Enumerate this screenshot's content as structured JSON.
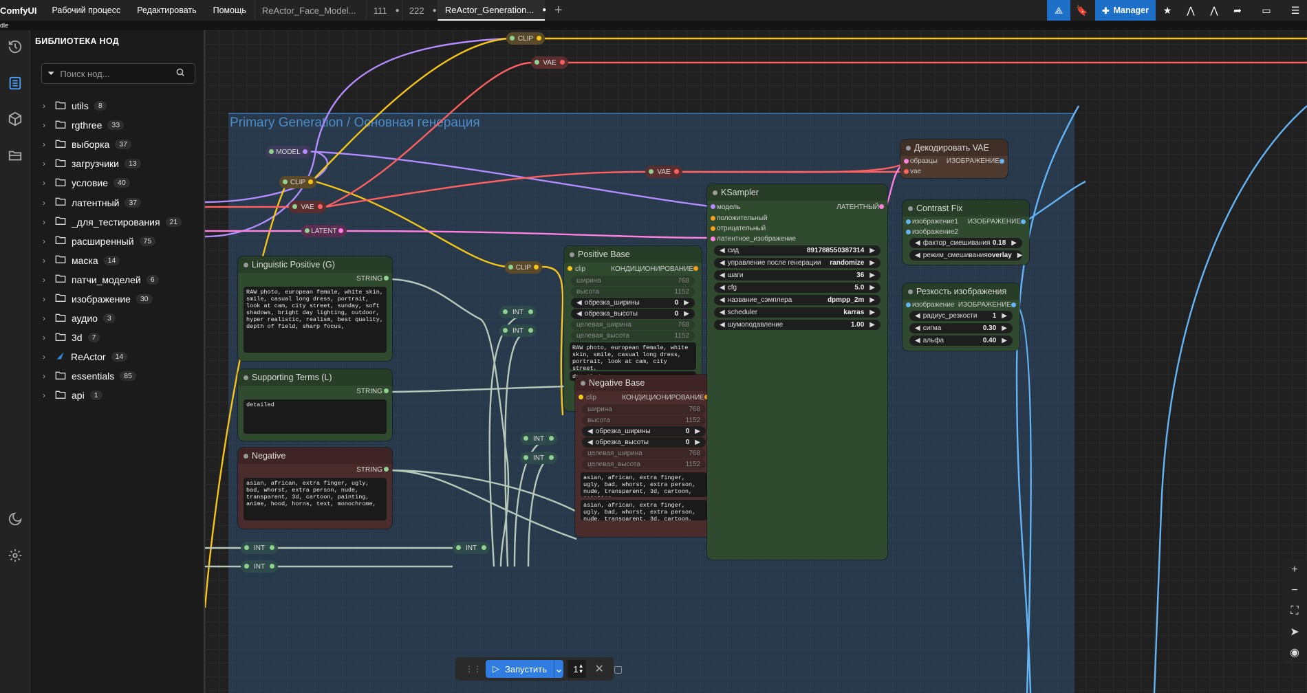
{
  "topbar": {
    "logo": "ComfyUI",
    "menu": [
      "Рабочий процесс",
      "Редактировать",
      "Помощь"
    ],
    "tabs": [
      {
        "label": "ReActor_Face_Model...",
        "active": false,
        "dot": ""
      },
      {
        "label": "111",
        "active": false,
        "dot": "●"
      },
      {
        "label": "222",
        "active": false,
        "dot": "●"
      },
      {
        "label": "ReActor_Generation...",
        "active": true,
        "dot": "●"
      }
    ],
    "add_tab": "+",
    "manager_label": "Manager"
  },
  "subbar_text": "dle",
  "library": {
    "title": "БИБЛИОТЕКА НОД",
    "search_placeholder": "Поиск нод...",
    "items": [
      {
        "label": "utils",
        "count": "8"
      },
      {
        "label": "rgthree",
        "count": "33"
      },
      {
        "label": "выборка",
        "count": "37"
      },
      {
        "label": "загрузчики",
        "count": "13"
      },
      {
        "label": "условие",
        "count": "40"
      },
      {
        "label": "латентный",
        "count": "37"
      },
      {
        "label": "_для_тестирования",
        "count": "21"
      },
      {
        "label": "расширенный",
        "count": "75"
      },
      {
        "label": "маска",
        "count": "14"
      },
      {
        "label": "патчи_моделей",
        "count": "6"
      },
      {
        "label": "изображение",
        "count": "30"
      },
      {
        "label": "аудио",
        "count": "3"
      },
      {
        "label": "3d",
        "count": "7"
      },
      {
        "label": "ReActor",
        "count": "14"
      },
      {
        "label": "essentials",
        "count": "85"
      },
      {
        "label": "api",
        "count": "1"
      }
    ]
  },
  "canvas": {
    "group_title": "Primary Generation / Основная генерация",
    "reroutes": {
      "clip": "CLIP",
      "vae": "VAE",
      "model": "MODEL",
      "latent": "LATENT",
      "int": "INT"
    },
    "linguistic": {
      "title": "Linguistic Positive (G)",
      "output": "STRING",
      "text": "RAW photo, european female, white skin, smile, casual long dress, portrait, look at cam, city street, sunday, soft shadows, bright day lighting, outdoor, hyper realistic, realism, best quality, depth of field, sharp focus,"
    },
    "supporting": {
      "title": "Supporting Terms (L)",
      "output": "STRING",
      "text": "detailed"
    },
    "negative": {
      "title": "Negative",
      "output": "STRING",
      "text": "asian, african, extra finger, ugly, bad, whorst, extra person, nude, transparent, 3d, cartoon, painting, anime, hood, horns, text, monochrome,"
    },
    "positive_base": {
      "title": "Positive Base",
      "input": "clip",
      "output": "КОНДИЦИОНИРОВАНИЕ",
      "width_label": "ширина",
      "width": "768",
      "height_label": "высота",
      "height": "1152",
      "crop_w_label": "обрезка_ширины",
      "crop_w": "0",
      "crop_h_label": "обрезка_высоты",
      "crop_h": "0",
      "target_w_label": "целевая_ширина",
      "target_w": "768",
      "target_h_label": "целевая_высота",
      "target_h": "1152",
      "text": "RAW photo, european female, white skin, smile, casual long dress, portrait, look at cam, city street,",
      "text2": "detailed"
    },
    "negative_base": {
      "title": "Negative Base",
      "input": "clip",
      "output": "КОНДИЦИОНИРОВАНИЕ",
      "width_label": "ширина",
      "width": "768",
      "height_label": "высота",
      "height": "1152",
      "crop_w_label": "обрезка_ширины",
      "crop_w": "0",
      "crop_h_label": "обрезка_высоты",
      "crop_h": "0",
      "target_w_label": "целевая_ширина",
      "target_w": "768",
      "target_h_label": "целевая_высота",
      "target_h": "1152",
      "text": "asian, african, extra finger, ugly, bad, whorst, extra person, nude, transparent, 3d, cartoon, painting,",
      "text2": "asian, african, extra finger, ugly, bad, whorst, extra person, nude, transparent, 3d, cartoon, painting,"
    },
    "ksampler": {
      "title": "KSampler",
      "in_model": "модель",
      "in_pos": "положительный",
      "in_neg": "отрицательный",
      "in_latent": "латентное_изображение",
      "output": "ЛАТЕНТНЫЙ",
      "seed_label": "сид",
      "seed": "891788550387314",
      "control_label": "управление после генерации",
      "control": "randomize",
      "steps_label": "шаги",
      "steps": "36",
      "cfg_label": "cfg",
      "cfg": "5.0",
      "sampler_label": "название_сэмплера",
      "sampler": "dpmpp_2m",
      "scheduler_label": "scheduler",
      "scheduler": "karras",
      "denoise_label": "шумоподавление",
      "denoise": "1.00"
    },
    "vae_decode": {
      "title": "Декодировать VAE",
      "in_samples": "образцы",
      "in_vae": "vae",
      "output": "ИЗОБРАЖЕНИЕ"
    },
    "contrast": {
      "title": "Contrast Fix",
      "in1": "изображение1",
      "in2": "изображение2",
      "output": "ИЗОБРАЖЕНИЕ",
      "factor_label": "фактор_смешивания",
      "factor": "0.18",
      "mode_label": "режим_смешивания",
      "mode": "overlay"
    },
    "sharpen": {
      "title": "Резкость изображения",
      "input": "изображение",
      "output": "ИЗОБРАЖЕНИЕ",
      "radius_label": "радиус_резкости",
      "radius": "1",
      "sigma_label": "сигма",
      "sigma": "0.30",
      "alpha_label": "альфа",
      "alpha": "0.40"
    }
  },
  "runbar": {
    "run_label": "Запустить",
    "count": "1"
  },
  "colors": {
    "accent": "#2f7de0",
    "clip": "#f5c518",
    "vae": "#ff6060",
    "model": "#b38cff",
    "latent": "#ff80e0",
    "string": "#8fd18f",
    "image": "#64b5f6"
  }
}
